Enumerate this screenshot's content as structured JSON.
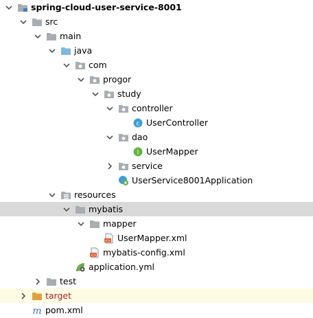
{
  "tree": {
    "items": [
      {
        "label": "spring-cloud-user-service-8001",
        "icon": "module-folder-icon",
        "expanded": true,
        "bold": true
      },
      {
        "label": "src",
        "icon": "folder-icon",
        "expanded": true
      },
      {
        "label": "main",
        "icon": "folder-icon",
        "expanded": true
      },
      {
        "label": "java",
        "icon": "source-root-folder-icon",
        "expanded": true
      },
      {
        "label": "com",
        "icon": "package-icon",
        "expanded": true
      },
      {
        "label": "progor",
        "icon": "package-icon",
        "expanded": true
      },
      {
        "label": "study",
        "icon": "package-icon",
        "expanded": true
      },
      {
        "label": "controller",
        "icon": "package-icon",
        "expanded": true
      },
      {
        "label": "UserController",
        "icon": "class-icon"
      },
      {
        "label": "dao",
        "icon": "package-icon",
        "expanded": true
      },
      {
        "label": "UserMapper",
        "icon": "interface-icon"
      },
      {
        "label": "service",
        "icon": "package-icon",
        "expanded": false
      },
      {
        "label": "UserService8001Application",
        "icon": "spring-boot-class-icon"
      },
      {
        "label": "resources",
        "icon": "resources-folder-icon",
        "expanded": true
      },
      {
        "label": "mybatis",
        "icon": "folder-icon",
        "expanded": true,
        "selected": true
      },
      {
        "label": "mapper",
        "icon": "folder-icon",
        "expanded": true
      },
      {
        "label": "UserMapper.xml",
        "icon": "xml-file-icon"
      },
      {
        "label": "mybatis-config.xml",
        "icon": "xml-file-icon"
      },
      {
        "label": "application.yml",
        "icon": "spring-config-file-icon"
      },
      {
        "label": "test",
        "icon": "folder-icon",
        "expanded": false
      },
      {
        "label": "target",
        "icon": "excluded-folder-icon",
        "expanded": false,
        "excluded": true
      },
      {
        "label": "pom.xml",
        "icon": "maven-file-icon"
      }
    ]
  },
  "colors": {
    "selection": "#d9d9d9",
    "excluded_background": "#fdfbe3",
    "excluded_text": "#b02020",
    "folder": "#a8adb3",
    "source_root": "#7fb8e0",
    "package_dot": "#ffffff",
    "class_icon": "#3d9fd8",
    "interface_icon": "#62b543",
    "excluded_folder": "#e0a040"
  }
}
